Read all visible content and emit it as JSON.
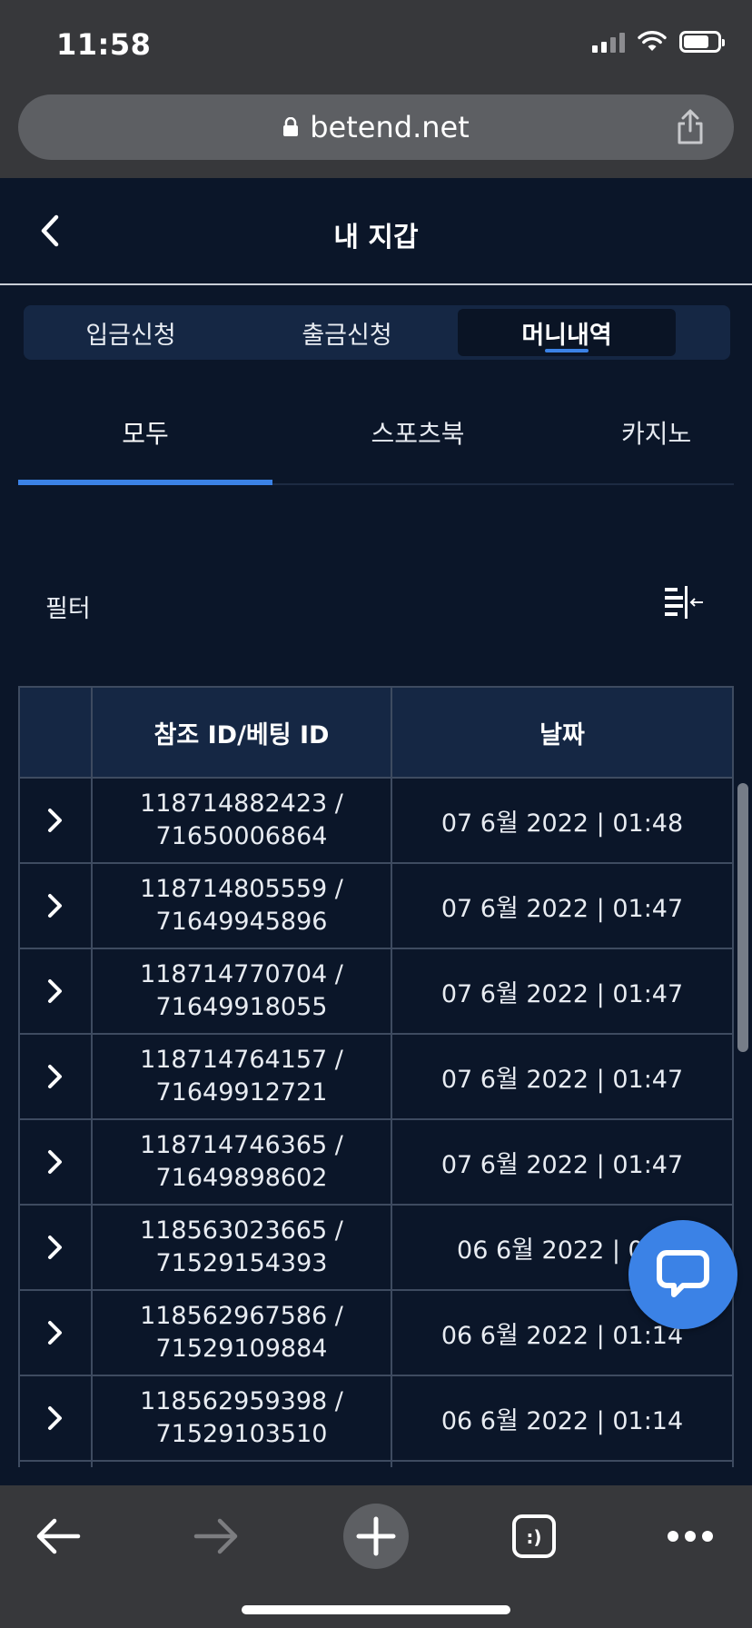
{
  "status_bar": {
    "time": "11:58"
  },
  "browser": {
    "url": "betend.net"
  },
  "header": {
    "title": "내 지갑"
  },
  "wallet_tabs": [
    {
      "label": "입금신청",
      "active": false
    },
    {
      "label": "출금신청",
      "active": false
    },
    {
      "label": "머니내역",
      "active": true
    }
  ],
  "category_tabs": [
    {
      "label": "모두",
      "active": true
    },
    {
      "label": "스포츠북",
      "active": false
    },
    {
      "label": "카지노",
      "active": false
    }
  ],
  "filter": {
    "label": "필터"
  },
  "table": {
    "columns": [
      "",
      "참조 ID/베팅 ID",
      "날짜"
    ],
    "rows": [
      {
        "ref_id": "118714882423 /",
        "bet_id": "71650006864",
        "date": "07 6월 2022 | 01:48"
      },
      {
        "ref_id": "118714805559 /",
        "bet_id": "71649945896",
        "date": "07 6월 2022 | 01:47"
      },
      {
        "ref_id": "118714770704 /",
        "bet_id": "71649918055",
        "date": "07 6월 2022 | 01:47"
      },
      {
        "ref_id": "118714764157 /",
        "bet_id": "71649912721",
        "date": "07 6월 2022 | 01:47"
      },
      {
        "ref_id": "118714746365 /",
        "bet_id": "71649898602",
        "date": "07 6월 2022 | 01:47"
      },
      {
        "ref_id": "118563023665 /",
        "bet_id": "71529154393",
        "date": "06 6월 2022 | 01:"
      },
      {
        "ref_id": "118562967586 /",
        "bet_id": "71529109884",
        "date": "06 6월 2022 | 01:14"
      },
      {
        "ref_id": "118562959398 /",
        "bet_id": "71529103510",
        "date": "06 6월 2022 | 01:14"
      }
    ]
  },
  "bottom_bar": {
    "tabs_badge": ":)"
  },
  "colors": {
    "accent": "#3b82e6",
    "background": "#0b1629",
    "header_cell": "#152744",
    "chrome": "#37383b"
  }
}
